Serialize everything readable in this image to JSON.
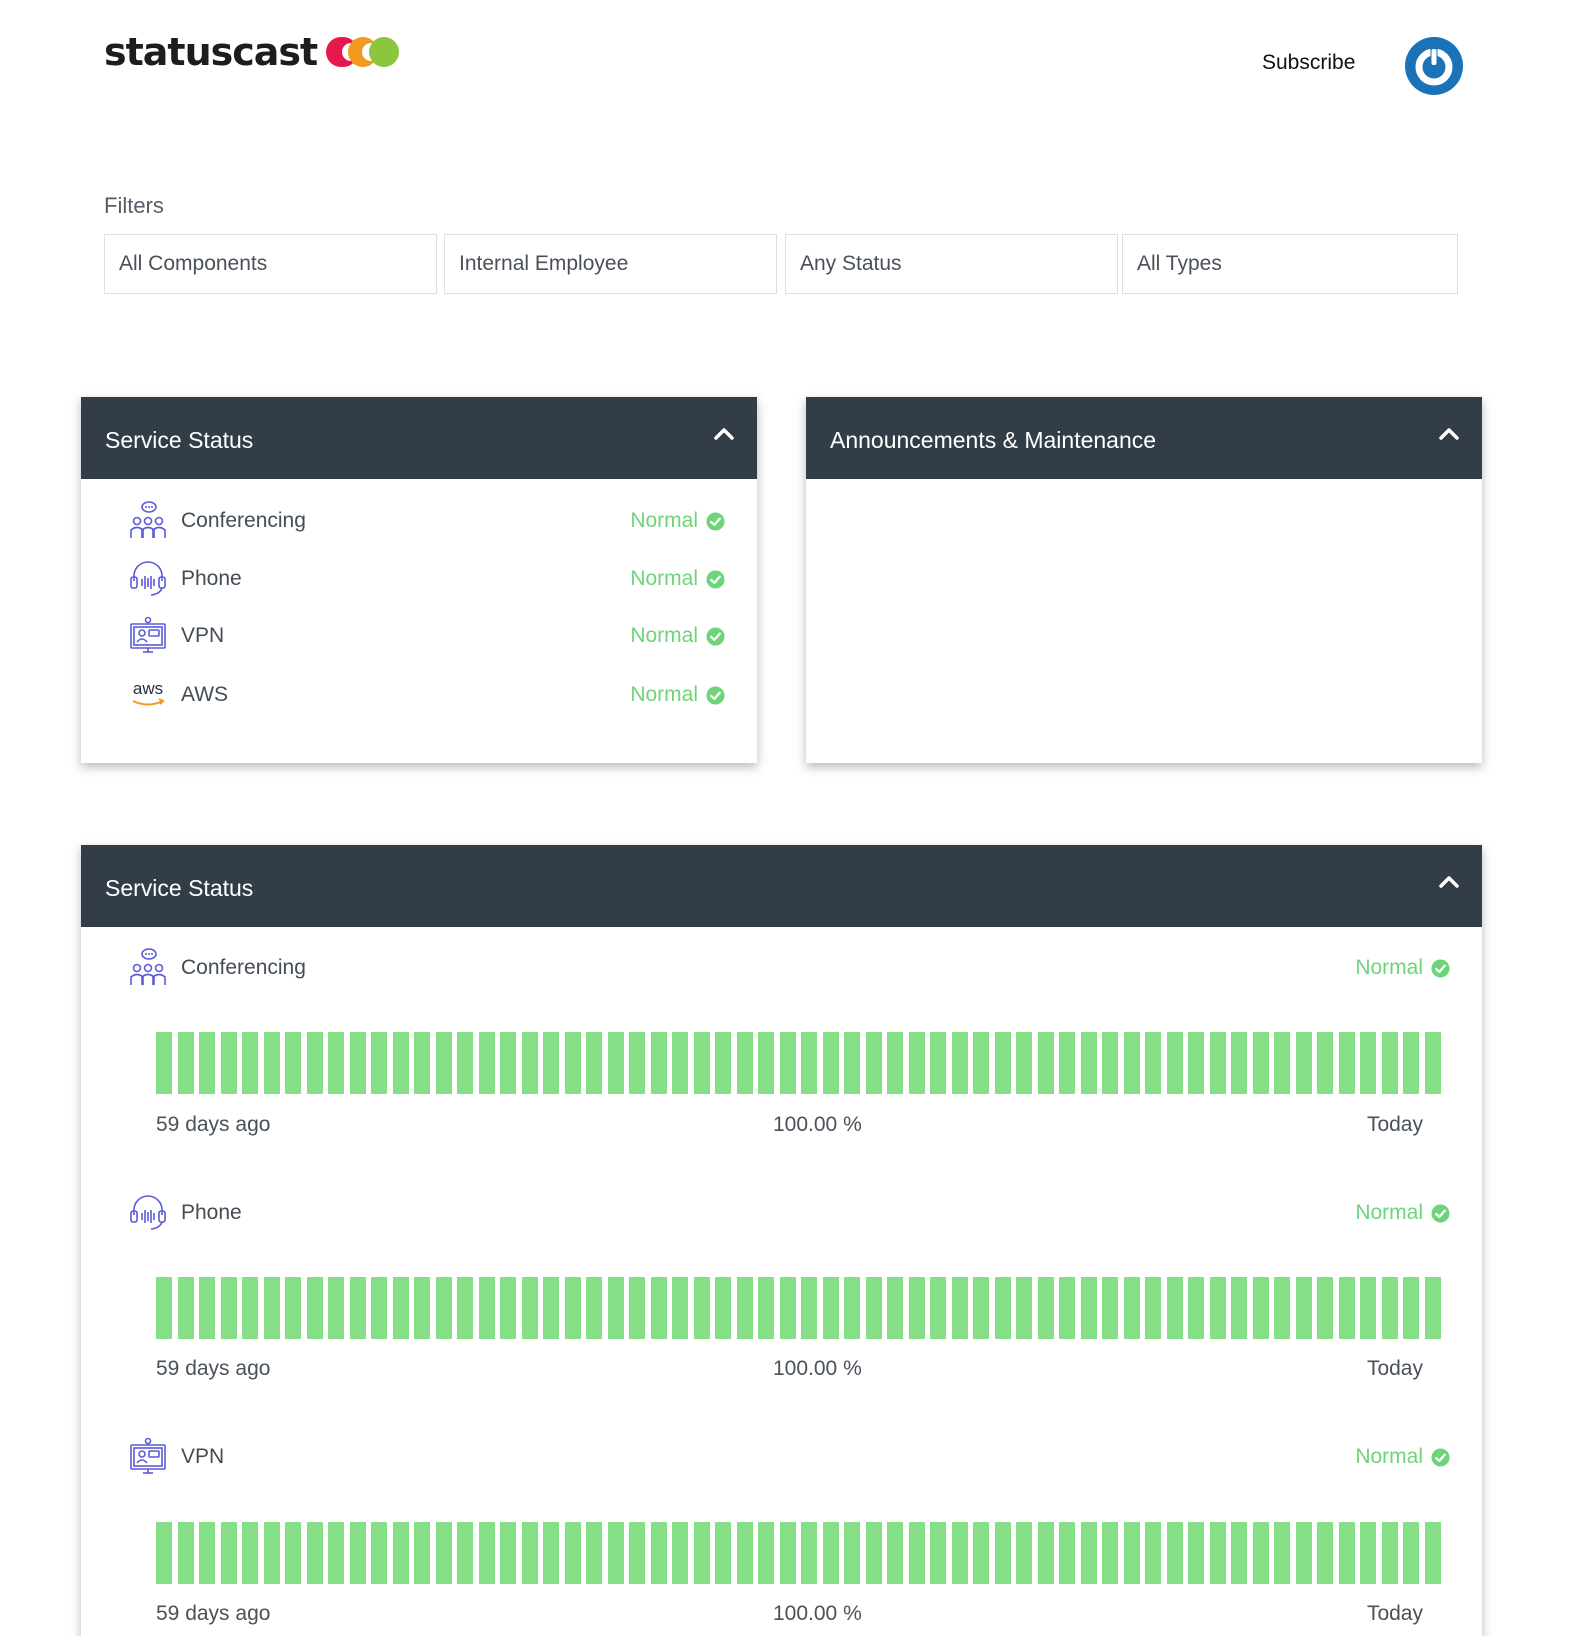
{
  "header": {
    "logo_text": "statuscast",
    "subscribe_label": "Subscribe",
    "brand_colors": [
      "#e5184e",
      "#f29a1f",
      "#8cc63f"
    ],
    "avatar_color": "#1a73b8"
  },
  "filters": {
    "label": "Filters",
    "components": "All Components",
    "audience": "Internal Employee",
    "status": "Any Status",
    "types": "All Types"
  },
  "summary_panel": {
    "title": "Service Status",
    "services": [
      {
        "name": "Conferencing",
        "status": "Normal",
        "icon": "conferencing-icon"
      },
      {
        "name": "Phone",
        "status": "Normal",
        "icon": "headset-icon"
      },
      {
        "name": "VPN",
        "status": "Normal",
        "icon": "vpn-icon"
      },
      {
        "name": "AWS",
        "status": "Normal",
        "icon": "aws-icon",
        "icon_text": "aws"
      }
    ]
  },
  "announcements_panel": {
    "title": "Announcements & Maintenance"
  },
  "detail_panel": {
    "title": "Service Status",
    "services": [
      {
        "name": "Conferencing",
        "status": "Normal",
        "icon": "conferencing-icon",
        "start_label": "59 days ago",
        "uptime": "100.00 %",
        "end_label": "Today",
        "days": 60
      },
      {
        "name": "Phone",
        "status": "Normal",
        "icon": "headset-icon",
        "start_label": "59 days ago",
        "uptime": "100.00 %",
        "end_label": "Today",
        "days": 60
      },
      {
        "name": "VPN",
        "status": "Normal",
        "icon": "vpn-icon",
        "start_label": "59 days ago",
        "uptime": "100.00 %",
        "end_label": "Today",
        "days": 60
      }
    ]
  },
  "colors": {
    "panel_header": "#333d47",
    "status_normal": "#6ed47a",
    "uptime_bar": "#86df86"
  }
}
